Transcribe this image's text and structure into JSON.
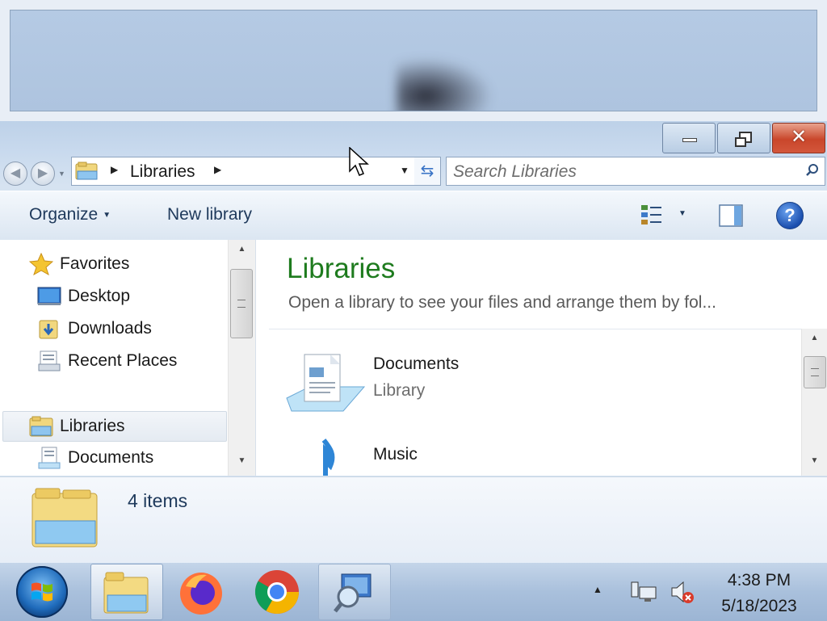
{
  "window": {
    "minimize_glyph": "—",
    "close_glyph": "✕"
  },
  "address_bar": {
    "crumb": "Libraries",
    "search_placeholder": "Search Libraries"
  },
  "command_bar": {
    "organize_label": "Organize",
    "new_library_label": "New library",
    "help_glyph": "?"
  },
  "nav_pane": {
    "items": [
      {
        "label": "Favorites",
        "icon": "star-icon"
      },
      {
        "label": "Desktop",
        "icon": "desktop-icon"
      },
      {
        "label": "Downloads",
        "icon": "downloads-folder-icon"
      },
      {
        "label": "Recent Places",
        "icon": "recent-places-icon"
      },
      {
        "label": "Libraries",
        "icon": "libraries-icon",
        "selected": true
      },
      {
        "label": "Documents",
        "icon": "documents-icon"
      }
    ]
  },
  "content": {
    "title": "Libraries",
    "subtitle": "Open a library to see your files and arrange them by fol...",
    "items": [
      {
        "name": "Documents",
        "type": "Library",
        "icon": "documents-library-icon"
      },
      {
        "name": "Music",
        "type": "",
        "icon": "music-library-icon"
      }
    ]
  },
  "details": {
    "count": "4 items"
  },
  "taskbar": {
    "buttons": [
      {
        "name": "windows-explorer",
        "icon": "explorer-icon",
        "state": "active"
      },
      {
        "name": "firefox",
        "icon": "firefox-icon",
        "state": "pinned"
      },
      {
        "name": "chrome",
        "icon": "chrome-icon",
        "state": "pinned"
      },
      {
        "name": "magnifier",
        "icon": "magnifier-icon",
        "state": "open"
      }
    ],
    "time": "4:38 PM",
    "date": "5/18/2023"
  },
  "colors": {
    "title_green": "#1e7b1e",
    "command_text": "#1e395b",
    "close_red": "#c9462b"
  }
}
